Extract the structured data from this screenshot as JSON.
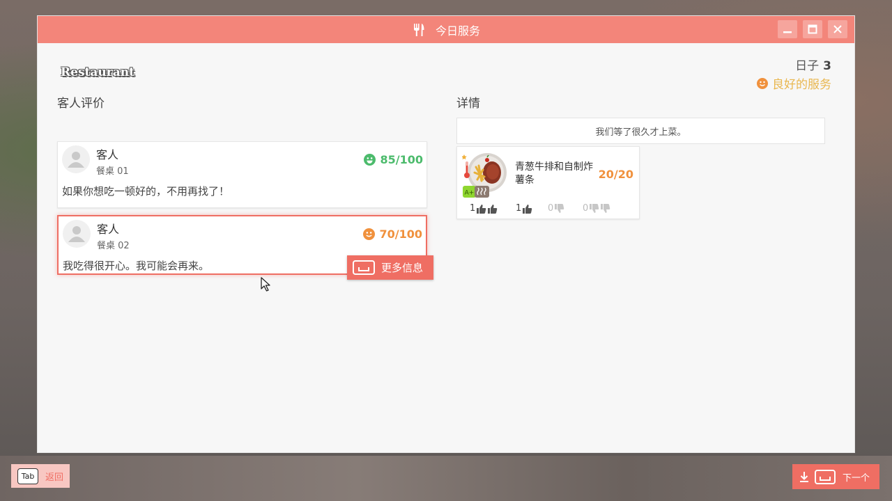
{
  "window": {
    "title": "今日服务"
  },
  "header": {
    "logo_text": "Restaurant",
    "day_label": "日子",
    "day_value": "3",
    "service_label": "良好的服务"
  },
  "reviews": {
    "heading": "客人评价",
    "items": [
      {
        "name": "客人",
        "table": "餐桌  01",
        "score": "85/100",
        "comment": "如果你想吃一顿好的，不用再找了！",
        "mood_color": "#4cbb6c"
      },
      {
        "name": "客人",
        "table": "餐桌  02",
        "score": "70/100",
        "comment": "我吃得很开心。我可能会再来。",
        "mood_color": "#f0913d"
      }
    ],
    "more_info_label": "更多信息"
  },
  "details": {
    "heading": "详情",
    "note": "我们等了很久才上菜。",
    "dish": {
      "name": "青葱牛排和自制炸薯条",
      "score": "20/20",
      "ratings": [
        {
          "count": "1",
          "icon": "double-thumbs-up-icon"
        },
        {
          "count": "1",
          "icon": "thumbs-up-icon"
        },
        {
          "count": "0",
          "icon": "thumbs-down-icon"
        },
        {
          "count": "0",
          "icon": "double-thumbs-down-icon"
        }
      ],
      "grade_badge": "A+"
    }
  },
  "footer": {
    "back_key": "Tab",
    "back_label": "返回",
    "next_label": "下一个"
  },
  "colors": {
    "accent": "#ef6e63",
    "titlebar": "#f3857a",
    "good": "#4cbb6c",
    "ok": "#f0913d",
    "service": "#e9b74f"
  }
}
